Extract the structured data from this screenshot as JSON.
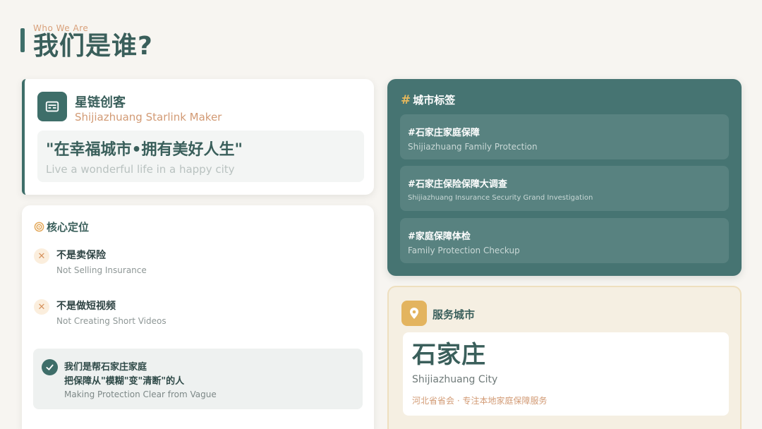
{
  "header": {
    "subtitle": "Who We Are",
    "title": "我们是谁?"
  },
  "brand": {
    "name": "星链创客",
    "name_en": "Shijiazhuang Starlink Maker",
    "slogan_zh": "\"在幸福城市•拥有美好人生\"",
    "slogan_en": "Live a wonderful life in a happy city"
  },
  "core": {
    "title": "核心定位",
    "not_items": [
      {
        "zh": "不是卖保险",
        "en": "Not Selling Insurance"
      },
      {
        "zh": "不是做短视频",
        "en": "Not Creating Short Videos"
      }
    ],
    "is_item": {
      "line1": "我们是帮石家庄家庭",
      "line2": "把保障从\"模糊\"变\"清断\"的人",
      "en": "Making Protection Clear from Vague"
    }
  },
  "tags": {
    "hash": "#",
    "title": "城市标签",
    "items": [
      {
        "zh": "#石家庄家庭保障",
        "en": "Shijiazhuang Family Protection"
      },
      {
        "zh": "#石家庄保险保障大调查",
        "en": "Shijiazhuang Insurance Security Grand Investigation"
      },
      {
        "zh": "#家庭保障体检",
        "en": "Family Protection Checkup"
      }
    ]
  },
  "city": {
    "title": "服务城市",
    "name": "石家庄",
    "name_en": "Shijiazhuang City",
    "note": "河北省省会 · 专注本地家庭保障服务"
  },
  "colors": {
    "primary": "#3e6e69",
    "accent": "#d29a74",
    "gold": "#e3b45f",
    "background": "#f7f5f1"
  },
  "icons": {
    "brand": "id-card-icon",
    "core": "target-icon",
    "no": "x-icon",
    "yes": "check-icon",
    "city": "map-pin-icon"
  }
}
